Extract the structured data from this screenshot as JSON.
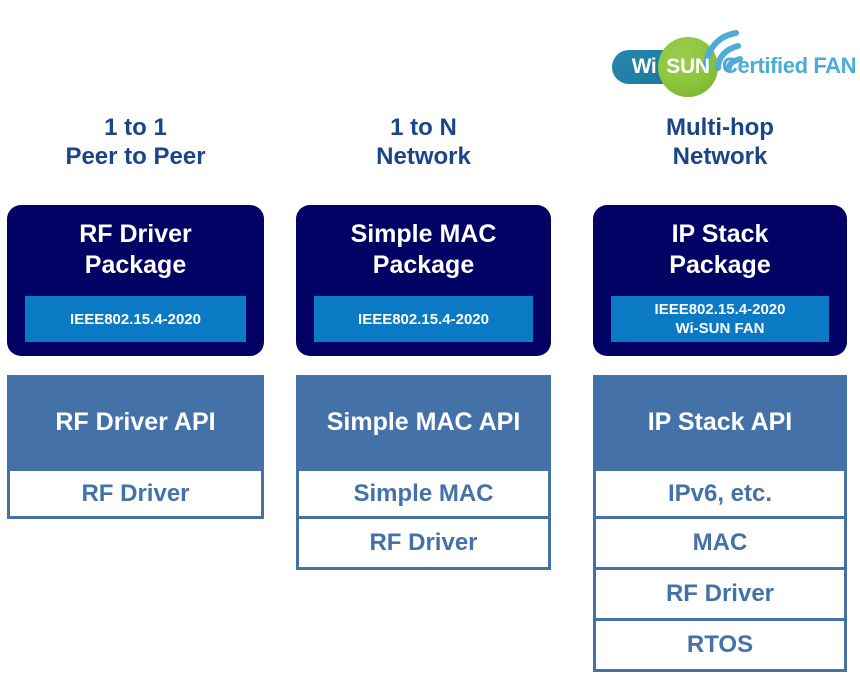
{
  "logo": {
    "name": "wisun-certified-fan-logo",
    "wi_text": "Wi",
    "sun_text": "SUN",
    "certified_text": "Certified FAN",
    "colors": {
      "pill_blue": "#1f7fa4",
      "circle_green": "#8cc63f",
      "certified_blue": "#4dabd8",
      "arc_blue": "#4dabd8"
    }
  },
  "theme": {
    "header_navy": "#1c4587",
    "package_navy": "#020265",
    "ribbon_blue": "#0b7ac4",
    "api_steel_blue": "#4472a8",
    "row_background": "#ffffff",
    "page_background": "#ffffff"
  },
  "columns": [
    {
      "id": "peer-to-peer",
      "header": "1 to 1\nPeer to Peer",
      "package": {
        "title": "RF Driver\nPackage",
        "ribbon": "IEEE802.15.4-2020"
      },
      "api_header": "RF Driver API",
      "rows": [
        "RF Driver"
      ]
    },
    {
      "id": "one-to-n-network",
      "header": "1 to N\nNetwork",
      "package": {
        "title": "Simple MAC\nPackage",
        "ribbon": "IEEE802.15.4-2020"
      },
      "api_header": "Simple MAC API",
      "rows": [
        "Simple MAC",
        "RF Driver"
      ]
    },
    {
      "id": "multi-hop-network",
      "header": "Multi-hop\nNetwork",
      "package": {
        "title": "IP Stack\nPackage",
        "ribbon": "IEEE802.15.4-2020\nWi-SUN FAN"
      },
      "api_header": "IP Stack API",
      "rows": [
        "IPv6, etc.",
        "MAC",
        "RF Driver",
        "RTOS"
      ]
    }
  ]
}
